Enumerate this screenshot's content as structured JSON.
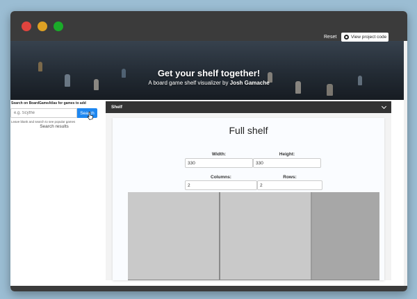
{
  "window": {
    "title_buttons": [
      "close-icon",
      "minimize-icon",
      "maximize-icon"
    ],
    "colors": {
      "close": "#e0443e",
      "minimize": "#dea123",
      "maximize": "#1aab29",
      "chrome": "#3b3b3b",
      "accent": "#1e87f0"
    }
  },
  "header": {
    "title": "Get your shelf together!",
    "subtitle_prefix": "A board game shelf visualizer by",
    "author": "Josh Gamache",
    "reset_label": "Reset",
    "project_button_label": "View project code",
    "project_icon": "github-icon"
  },
  "sidebar": {
    "search_label": "Search on BoardGameAtlas for games to add",
    "search_placeholder": "e.g. Scythe",
    "search_button_label": "Search",
    "hint": "Leave blank and search to see popular games",
    "results_label": "Search results"
  },
  "shelf": {
    "section_label": "Shelf",
    "card_title": "Full shelf",
    "width_label": "Width:",
    "width_value": "330",
    "height_label": "Height:",
    "height_value": "330",
    "columns_label": "Columns:",
    "columns_value": "2",
    "rows_label": "Rows:",
    "rows_value": "2"
  }
}
